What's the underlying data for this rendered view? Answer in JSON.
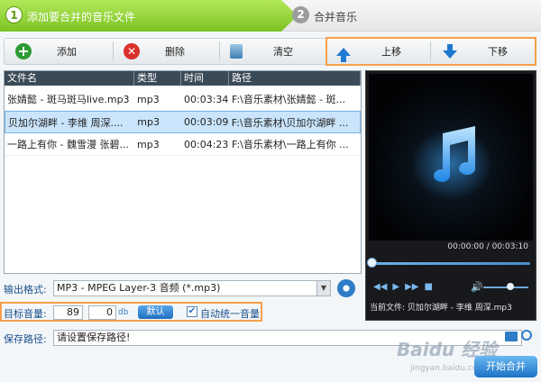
{
  "steps": [
    {
      "num": "1",
      "label": "添加要合并的音乐文件"
    },
    {
      "num": "2",
      "label": "合并音乐"
    }
  ],
  "toolbar": {
    "add": "添加",
    "delete": "删除",
    "clear": "清空",
    "move_up": "上移",
    "move_down": "下移"
  },
  "list": {
    "headers": [
      "文件名",
      "类型",
      "时间",
      "路径"
    ],
    "rows": [
      {
        "name": "张婧懿 - 斑马斑马live.mp3",
        "type": "mp3",
        "time": "00:03:34",
        "path": "F:\\音乐素材\\张婧懿 - 斑..."
      },
      {
        "name": "贝加尔湖畔 - 李维 周深....",
        "type": "mp3",
        "time": "00:03:09",
        "path": "F:\\音乐素材\\贝加尔湖畔 ..."
      },
      {
        "name": "一路上有你 - 魏雪漫 张碧...",
        "type": "mp3",
        "time": "00:04:23",
        "path": "F:\\音乐素材\\一路上有你 ..."
      }
    ]
  },
  "player": {
    "timer": "00:00:00 / 00:03:10",
    "current_label": "当前文件:",
    "current_file": "贝加尔湖畔 - 李维 周深.mp3",
    "seek_progress": 0,
    "volume_level": 0.6
  },
  "form": {
    "format_label": "输出格式:",
    "format_value": "MP3 - MPEG Layer-3 音频 (*.mp3)",
    "volume_label": "目标音量:",
    "volume_value": "89",
    "db_value": "0",
    "db_unit": "db",
    "default_btn": "默认",
    "auto_volume_label": "自动统一音量",
    "auto_volume_checked": true,
    "save_label": "保存路径:",
    "save_value": "请设置保存路径!"
  },
  "start_button": "开始合并",
  "watermark": {
    "logo": "Baidu 经验",
    "url": "jingyan.baidu.com"
  },
  "colors": {
    "accent": "#1f7ad0",
    "step_active": "#7cc324",
    "highlight_box": "#f5a04a"
  }
}
